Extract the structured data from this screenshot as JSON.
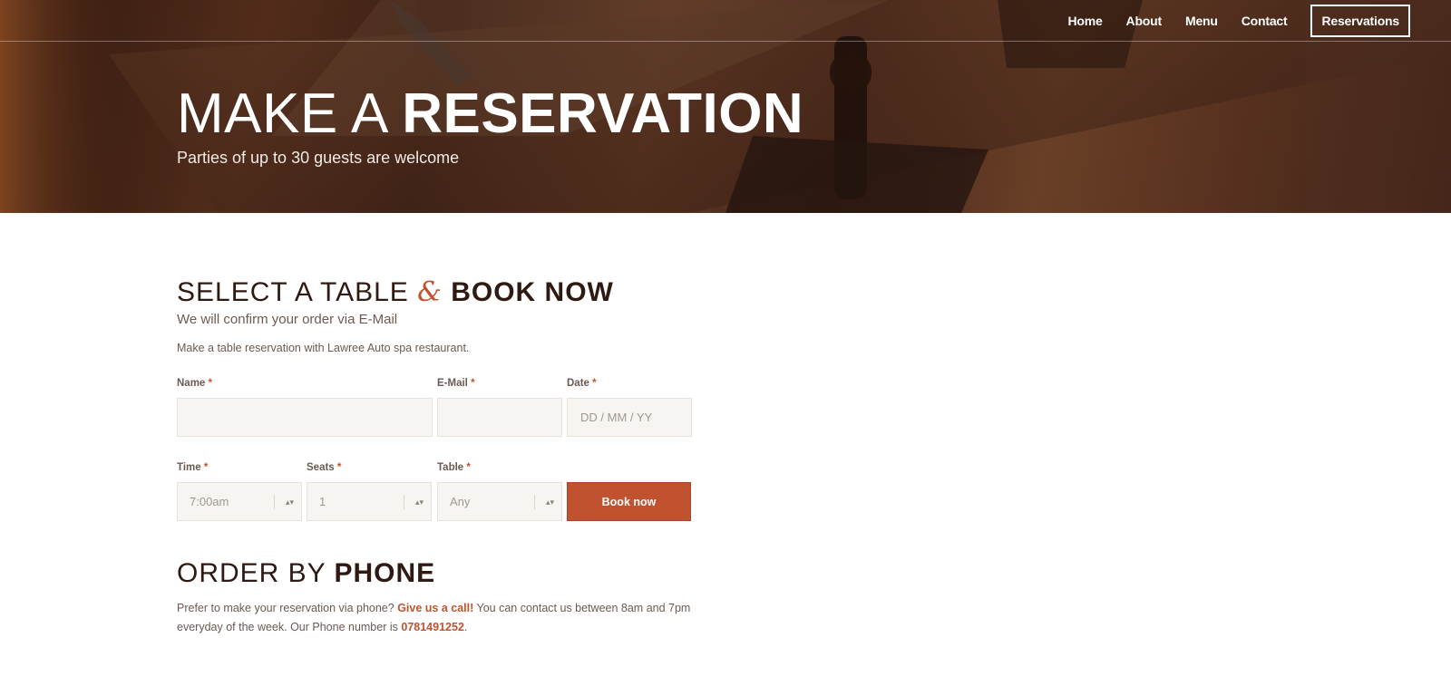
{
  "nav": {
    "items": [
      "Home",
      "About",
      "Menu",
      "Contact"
    ],
    "cta": "Reservations"
  },
  "hero": {
    "title_light": "MAKE A",
    "title_bold": "RESERVATION",
    "subtitle": "Parties of up to 30 guests are welcome"
  },
  "booking": {
    "title_light": "SELECT A TABLE",
    "title_amp": "&",
    "title_bold": "BOOK NOW",
    "subtitle": "We will confirm your order via E-Mail",
    "text": "Make a table reservation with Lawree Auto spa restaurant.",
    "fields": {
      "name": {
        "label": "Name",
        "value": ""
      },
      "email": {
        "label": "E-Mail",
        "value": ""
      },
      "date": {
        "label": "Date",
        "placeholder": "DD / MM / YY"
      },
      "time": {
        "label": "Time",
        "value": "7:00am"
      },
      "seats": {
        "label": "Seats",
        "value": "1"
      },
      "table": {
        "label": "Table",
        "value": "Any"
      }
    },
    "required_mark": "*",
    "submit": "Book now"
  },
  "phone": {
    "title_light": "ORDER BY",
    "title_bold": "PHONE",
    "text_before": "Prefer to make your reservation via phone?",
    "link": "Give us a call!",
    "text_after": "You can contact us between 8am and 7pm everyday of the week. Our Phone number is",
    "number": "0781491252",
    "end": "."
  },
  "colors": {
    "accent": "#c1522f",
    "heading": "#2e1a12",
    "text": "#6b5a53",
    "field_bg": "#f7f5f1"
  }
}
